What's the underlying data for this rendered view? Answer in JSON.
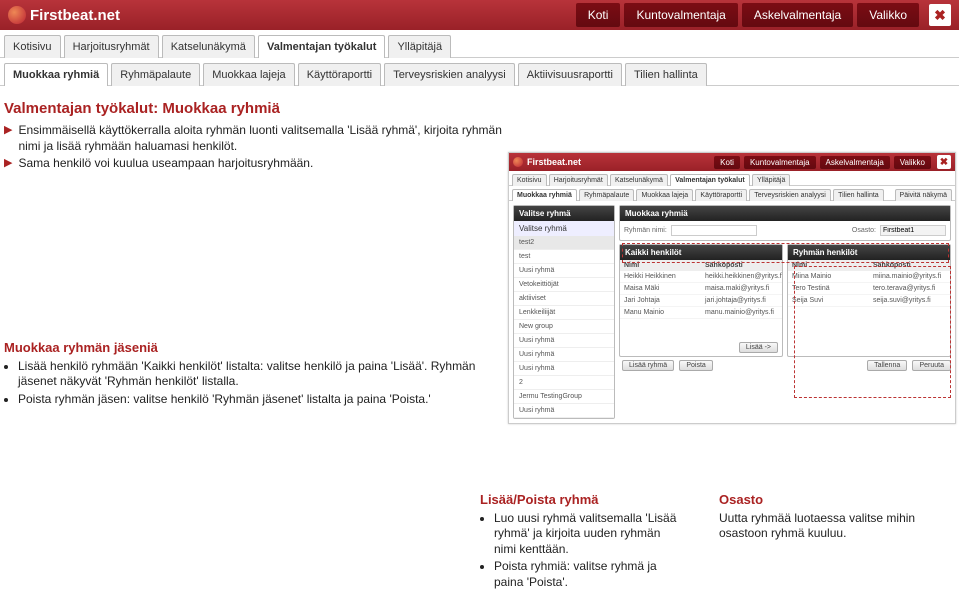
{
  "brand": "Firstbeat.net",
  "topnav": {
    "koti": "Koti",
    "kunto": "Kuntovalmentaja",
    "askel": "Askelvalmentaja",
    "valikko": "Valikko"
  },
  "tabs1": {
    "kotisivu": "Kotisivu",
    "harjoitus": "Harjoitusryhmät",
    "katselu": "Katselunäkymä",
    "valmentajan": "Valmentajan työkalut",
    "yllapitaja": "Ylläpitäjä"
  },
  "tabs2": {
    "muokkaa": "Muokkaa ryhmiä",
    "palaute": "Ryhmäpalaute",
    "lajeja": "Muokkaa lajeja",
    "kaytto": "Käyttöraportti",
    "terveys": "Terveysriskien analyysi",
    "akt": "Aktiivisuusraportti",
    "tilien": "Tilien hallinta"
  },
  "help": {
    "title": "Valmentajan työkalut: Muokkaa ryhmiä",
    "line1": "Ensimmäisellä käyttökerralla aloita ryhmän luonti valitsemalla 'Lisää ryhmä', kirjoita ryhmän nimi ja lisää ryhmään haluamasi henkilöt.",
    "line2": "Sama henkilö voi kuulua useampaan harjoitusryhmään.",
    "sec2title": "Muokkaa ryhmän jäseniä",
    "sec2a": "Lisää henkilö ryhmään 'Kaikki henkilöt' listalta: valitse henkilö ja paina 'Lisää'. Ryhmän jäsenet näkyvät 'Ryhmän henkilöt' listalla.",
    "sec2b": "Poista ryhmän jäsen: valitse henkilö 'Ryhmän jäsenet' listalta ja paina 'Poista.'",
    "sec3title": "Lisää/Poista ryhmä",
    "sec3a": "Luo uusi ryhmä valitsemalla 'Lisää ryhmä' ja kirjoita uuden ryhmän nimi kenttään.",
    "sec3b": "Poista ryhmiä: valitse ryhmä ja paina 'Poista'.",
    "sec4title": "Osasto",
    "sec4a": "Uutta ryhmää luotaessa valitse mihin osastoon ryhmä kuuluu."
  },
  "inset": {
    "paivita": "Päivitä näkymä",
    "valitse_ryhma": "Valitse ryhmä",
    "valitse_ryhma_light": "Valitse ryhmä",
    "muokkaa_ryhmia": "Muokkaa ryhmiä",
    "ryhman_nimi": "Ryhmän nimi:",
    "osasto": "Osasto:",
    "osasto_val": "Firstbeat1",
    "kaikki": "Kaikki henkilöt",
    "ryhman_h": "Ryhmän henkilöt",
    "nimi": "Nimi",
    "sp": "Sähköposti",
    "groups": [
      "test2",
      "test",
      "Uusi ryhmä",
      "Vetokeittiöjät",
      "aktiiviset",
      "Lenkkeiliijät",
      "New group",
      "Uusi ryhmä",
      "Uusi ryhmä",
      "Uusi ryhmä",
      "2",
      "Jermu TestingGroup",
      "Uusi ryhmä"
    ],
    "left_people": [
      {
        "n": "Heikki Heikkinen",
        "e": "heikki.heikkinen@yritys.fi"
      },
      {
        "n": "Maisa Mäki",
        "e": "maisa.maki@yritys.fi"
      },
      {
        "n": "Jari Johtaja",
        "e": "jari.johtaja@yritys.fi"
      },
      {
        "n": "Manu Mainio",
        "e": "manu.mainio@yritys.fi"
      }
    ],
    "right_people": [
      {
        "n": "Miina Mainio",
        "e": "miina.mainio@yritys.fi"
      },
      {
        "n": "Tero Testinä",
        "e": "tero.terava@yritys.fi"
      },
      {
        "n": "Seija Suvi",
        "e": "seija.suvi@yritys.fi"
      }
    ],
    "btn_lisaa": "Lisää ->",
    "btn_lisaa_ryhma": "Lisää ryhmä",
    "btn_poista": "Poista",
    "btn_tallenna": "Tallenna",
    "btn_peruuta": "Peruuta"
  }
}
